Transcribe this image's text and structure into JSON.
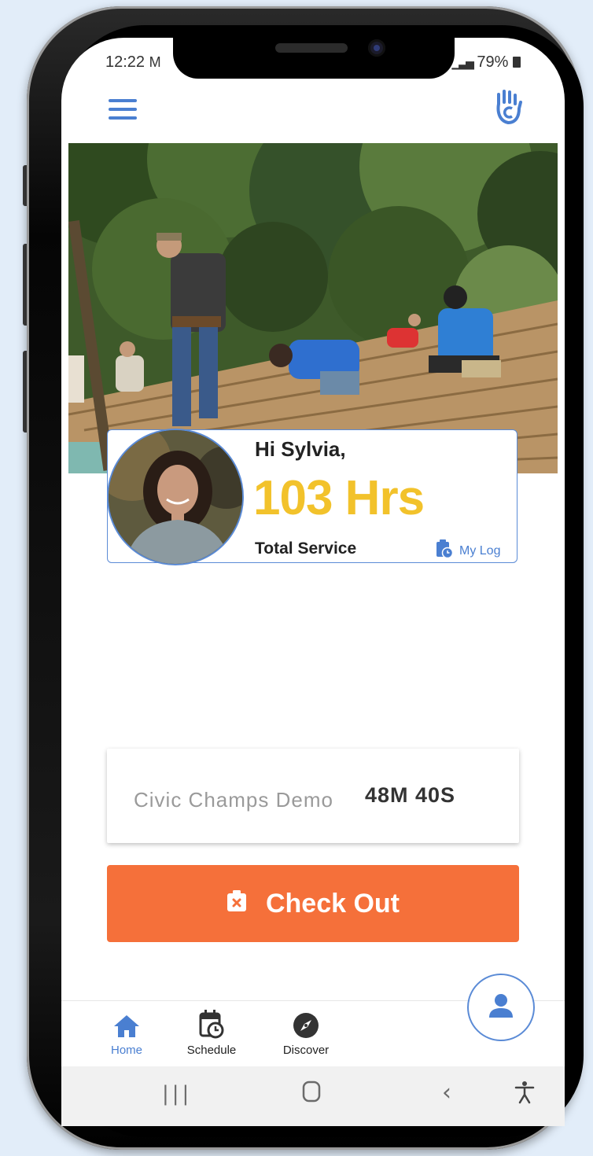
{
  "status_bar": {
    "time": "12:22",
    "battery": "79%"
  },
  "profile": {
    "greeting": "Hi Sylvia,",
    "hours": "103 Hrs",
    "total_label": "Total Service",
    "my_log_label": "My Log"
  },
  "activity": {
    "name": "Civic Champs Demo",
    "elapsed": "48M 40S"
  },
  "checkout": {
    "label": "Check Out"
  },
  "nav": {
    "items": [
      {
        "label": "Home",
        "icon": "home-icon",
        "active": true
      },
      {
        "label": "Schedule",
        "icon": "calendar-clock-icon",
        "active": false
      },
      {
        "label": "Discover",
        "icon": "compass-icon",
        "active": false
      }
    ]
  },
  "colors": {
    "accent": "#4a7fd1",
    "hours": "#f2c22b",
    "checkout": "#f5703a"
  }
}
